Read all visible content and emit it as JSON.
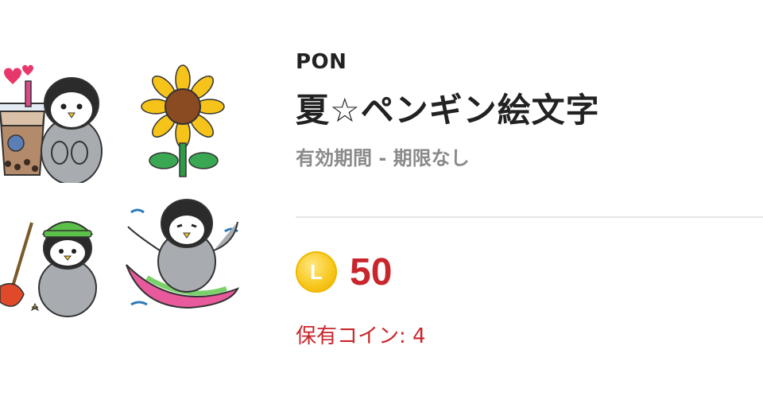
{
  "product": {
    "author": "PON",
    "title": "夏☆ペンギン絵文字",
    "validity": "有効期間 - 期限なし"
  },
  "price": {
    "coin_letter": "L",
    "amount": "50"
  },
  "owned": {
    "label": "保有コイン: 4"
  },
  "stickers": [
    {
      "icon": "penguin-bubble-tea-icon"
    },
    {
      "icon": "sunflower-icon"
    },
    {
      "icon": "penguin-fishing-icon"
    },
    {
      "icon": "penguin-surfing-icon"
    }
  ],
  "colors": {
    "price_red": "#c8262c",
    "coin_gold": "#f8c81e",
    "text_dark": "#222222",
    "text_gray": "#8a8a8a"
  }
}
